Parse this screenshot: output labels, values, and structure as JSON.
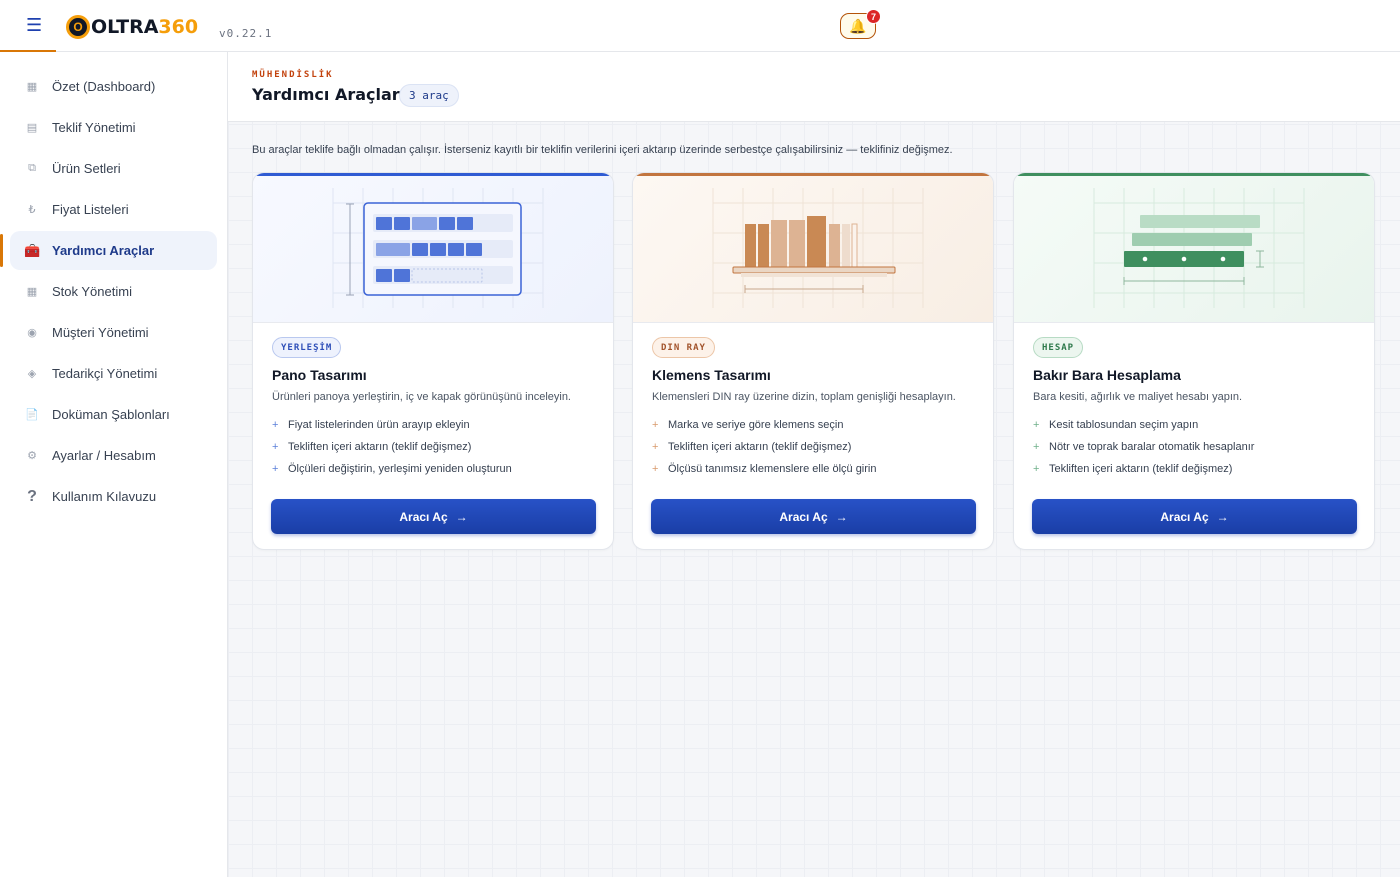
{
  "header": {
    "menu_icon": "hamburger-icon",
    "logo_mark": "O",
    "logo_text_main": "OLTRA",
    "logo_text_accent": "360",
    "version": "v0.22.1",
    "notification_count": "7",
    "bell_icon": "🔔"
  },
  "sidebar": {
    "items": [
      {
        "label": "Özet (Dashboard)",
        "icon": "▦"
      },
      {
        "label": "Teklif Yönetimi",
        "icon": "▤"
      },
      {
        "label": "Ürün Setleri",
        "icon": "⧉"
      },
      {
        "label": "Fiyat Listeleri",
        "icon": "₺"
      },
      {
        "label": "Yardımcı Araçlar",
        "icon": "🧰"
      },
      {
        "label": "Stok Yönetimi",
        "icon": "▦"
      },
      {
        "label": "Müşteri Yönetimi",
        "icon": "◉"
      },
      {
        "label": "Tedarikçi Yönetimi",
        "icon": "◈"
      },
      {
        "label": "Doküman Şablonları",
        "icon": "📄"
      },
      {
        "label": "Ayarlar / Hesabım",
        "icon": "⚙"
      },
      {
        "label": "Kullanım Kılavuzu",
        "icon": "?"
      }
    ],
    "active_index": 4
  },
  "page": {
    "eyebrow": "MÜHENDİSLİK",
    "title": "Yardımcı Araçlar",
    "count": "3 araç",
    "intro": "Bu araçlar teklife bağlı olmadan çalışır. İsterseniz kayıtlı bir teklifin verilerini içeri aktarıp üzerinde serbestçe çalışabilirsiniz — teklifiniz değişmez."
  },
  "cards": [
    {
      "tag": "YERLEŞİM",
      "title": "Pano Tasarımı",
      "desc": "Ürünleri panoya yerleştirin, iç ve kapak görünüşünü inceleyin.",
      "features": [
        "Fiyat listelerinden ürün arayıp ekleyin",
        "Tekliften içeri aktarın (teklif değişmez)",
        "Ölçüleri değiştirin, yerleşimi yeniden oluşturun"
      ],
      "button": "Aracı Aç",
      "arrow": "→"
    },
    {
      "tag": "DIN RAY",
      "title": "Klemens Tasarımı",
      "desc": "Klemensleri DIN ray üzerine dizin, toplam genişliği hesaplayın.",
      "features": [
        "Marka ve seriye göre klemens seçin",
        "Tekliften içeri aktarın (teklif değişmez)",
        "Ölçüsü tanımsız klemenslere elle ölçü girin"
      ],
      "button": "Aracı Aç",
      "arrow": "→"
    },
    {
      "tag": "HESAP",
      "title": "Bakır Bara Hesaplama",
      "desc": "Bara kesiti, ağırlık ve maliyet hesabı yapın.",
      "features": [
        "Kesit tablosundan seçim yapın",
        "Nötr ve toprak baralar otomatik hesaplanır",
        "Tekliften içeri aktarın (teklif değişmez)"
      ],
      "button": "Aracı Aç",
      "arrow": "→"
    }
  ],
  "colors": {
    "brand_blue": "#1e40af",
    "accent_orange": "#d97706",
    "card1_accent": "#2f5bd3",
    "card2_accent": "#c2753f",
    "card3_accent": "#3f8f5f"
  }
}
